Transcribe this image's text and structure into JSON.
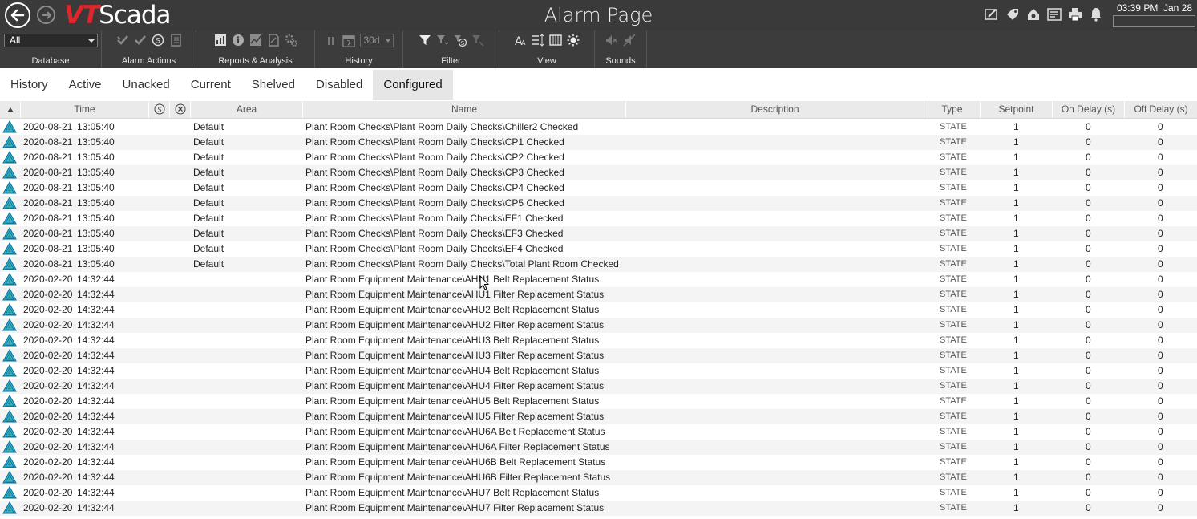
{
  "titlebar": {
    "logo_vt": "VT",
    "logo_scada": "Scada",
    "page_title": "Alarm Page",
    "time": "03:39 PM",
    "date": "Jan 28",
    "icons": [
      "draw-icon",
      "tag-icon",
      "home-settings-icon",
      "add-list-icon",
      "print-icon",
      "bell-icon"
    ]
  },
  "toolbar": {
    "database_value": "All",
    "history_range": "30d",
    "groups": [
      {
        "label": "Database"
      },
      {
        "label": "Alarm Actions"
      },
      {
        "label": "Reports & Analysis"
      },
      {
        "label": "History"
      },
      {
        "label": "Filter"
      },
      {
        "label": "View"
      },
      {
        "label": "Sounds"
      }
    ]
  },
  "tabs": [
    "History",
    "Active",
    "Unacked",
    "Current",
    "Shelved",
    "Disabled",
    "Configured"
  ],
  "active_tab": "Configured",
  "columns": {
    "time": "Time",
    "area": "Area",
    "name": "Name",
    "description": "Description",
    "type": "Type",
    "setpoint": "Setpoint",
    "on_delay": "On Delay (s)",
    "off_delay": "Off Delay (s)"
  },
  "rows": [
    {
      "date": "2020-08-21",
      "time": "13:05:40",
      "area": "Default",
      "name": "Plant Room Checks\\Plant Room Daily Checks\\Chiller2 Checked",
      "type": "STATE",
      "setpoint": "1",
      "on": "0",
      "off": "0"
    },
    {
      "date": "2020-08-21",
      "time": "13:05:40",
      "area": "Default",
      "name": "Plant Room Checks\\Plant Room Daily Checks\\CP1 Checked",
      "type": "STATE",
      "setpoint": "1",
      "on": "0",
      "off": "0"
    },
    {
      "date": "2020-08-21",
      "time": "13:05:40",
      "area": "Default",
      "name": "Plant Room Checks\\Plant Room Daily Checks\\CP2 Checked",
      "type": "STATE",
      "setpoint": "1",
      "on": "0",
      "off": "0"
    },
    {
      "date": "2020-08-21",
      "time": "13:05:40",
      "area": "Default",
      "name": "Plant Room Checks\\Plant Room Daily Checks\\CP3 Checked",
      "type": "STATE",
      "setpoint": "1",
      "on": "0",
      "off": "0"
    },
    {
      "date": "2020-08-21",
      "time": "13:05:40",
      "area": "Default",
      "name": "Plant Room Checks\\Plant Room Daily Checks\\CP4 Checked",
      "type": "STATE",
      "setpoint": "1",
      "on": "0",
      "off": "0"
    },
    {
      "date": "2020-08-21",
      "time": "13:05:40",
      "area": "Default",
      "name": "Plant Room Checks\\Plant Room Daily Checks\\CP5 Checked",
      "type": "STATE",
      "setpoint": "1",
      "on": "0",
      "off": "0"
    },
    {
      "date": "2020-08-21",
      "time": "13:05:40",
      "area": "Default",
      "name": "Plant Room Checks\\Plant Room Daily Checks\\EF1 Checked",
      "type": "STATE",
      "setpoint": "1",
      "on": "0",
      "off": "0"
    },
    {
      "date": "2020-08-21",
      "time": "13:05:40",
      "area": "Default",
      "name": "Plant Room Checks\\Plant Room Daily Checks\\EF3 Checked",
      "type": "STATE",
      "setpoint": "1",
      "on": "0",
      "off": "0"
    },
    {
      "date": "2020-08-21",
      "time": "13:05:40",
      "area": "Default",
      "name": "Plant Room Checks\\Plant Room Daily Checks\\EF4 Checked",
      "type": "STATE",
      "setpoint": "1",
      "on": "0",
      "off": "0"
    },
    {
      "date": "2020-08-21",
      "time": "13:05:40",
      "area": "Default",
      "name": "Plant Room Checks\\Plant Room Daily Checks\\Total Plant Room Checked",
      "type": "STATE",
      "setpoint": "1",
      "on": "0",
      "off": "0"
    },
    {
      "date": "2020-02-20",
      "time": "14:32:44",
      "area": "",
      "name": "Plant Room Equipment Maintenance\\AHU1 Belt Replacement Status",
      "type": "STATE",
      "setpoint": "1",
      "on": "0",
      "off": "0"
    },
    {
      "date": "2020-02-20",
      "time": "14:32:44",
      "area": "",
      "name": "Plant Room Equipment Maintenance\\AHU1 Filter Replacement Status",
      "type": "STATE",
      "setpoint": "1",
      "on": "0",
      "off": "0"
    },
    {
      "date": "2020-02-20",
      "time": "14:32:44",
      "area": "",
      "name": "Plant Room Equipment Maintenance\\AHU2 Belt Replacement Status",
      "type": "STATE",
      "setpoint": "1",
      "on": "0",
      "off": "0"
    },
    {
      "date": "2020-02-20",
      "time": "14:32:44",
      "area": "",
      "name": "Plant Room Equipment Maintenance\\AHU2 Filter Replacement Status",
      "type": "STATE",
      "setpoint": "1",
      "on": "0",
      "off": "0"
    },
    {
      "date": "2020-02-20",
      "time": "14:32:44",
      "area": "",
      "name": "Plant Room Equipment Maintenance\\AHU3 Belt Replacement Status",
      "type": "STATE",
      "setpoint": "1",
      "on": "0",
      "off": "0"
    },
    {
      "date": "2020-02-20",
      "time": "14:32:44",
      "area": "",
      "name": "Plant Room Equipment Maintenance\\AHU3 Filter Replacement Status",
      "type": "STATE",
      "setpoint": "1",
      "on": "0",
      "off": "0"
    },
    {
      "date": "2020-02-20",
      "time": "14:32:44",
      "area": "",
      "name": "Plant Room Equipment Maintenance\\AHU4 Belt Replacement Status",
      "type": "STATE",
      "setpoint": "1",
      "on": "0",
      "off": "0"
    },
    {
      "date": "2020-02-20",
      "time": "14:32:44",
      "area": "",
      "name": "Plant Room Equipment Maintenance\\AHU4 Filter Replacement Status",
      "type": "STATE",
      "setpoint": "1",
      "on": "0",
      "off": "0"
    },
    {
      "date": "2020-02-20",
      "time": "14:32:44",
      "area": "",
      "name": "Plant Room Equipment Maintenance\\AHU5 Belt Replacement Status",
      "type": "STATE",
      "setpoint": "1",
      "on": "0",
      "off": "0"
    },
    {
      "date": "2020-02-20",
      "time": "14:32:44",
      "area": "",
      "name": "Plant Room Equipment Maintenance\\AHU5 Filter Replacement Status",
      "type": "STATE",
      "setpoint": "1",
      "on": "0",
      "off": "0"
    },
    {
      "date": "2020-02-20",
      "time": "14:32:44",
      "area": "",
      "name": "Plant Room Equipment Maintenance\\AHU6A Belt Replacement Status",
      "type": "STATE",
      "setpoint": "1",
      "on": "0",
      "off": "0"
    },
    {
      "date": "2020-02-20",
      "time": "14:32:44",
      "area": "",
      "name": "Plant Room Equipment Maintenance\\AHU6A Filter Replacement Status",
      "type": "STATE",
      "setpoint": "1",
      "on": "0",
      "off": "0"
    },
    {
      "date": "2020-02-20",
      "time": "14:32:44",
      "area": "",
      "name": "Plant Room Equipment Maintenance\\AHU6B Belt Replacement Status",
      "type": "STATE",
      "setpoint": "1",
      "on": "0",
      "off": "0"
    },
    {
      "date": "2020-02-20",
      "time": "14:32:44",
      "area": "",
      "name": "Plant Room Equipment Maintenance\\AHU6B Filter Replacement Status",
      "type": "STATE",
      "setpoint": "1",
      "on": "0",
      "off": "0"
    },
    {
      "date": "2020-02-20",
      "time": "14:32:44",
      "area": "",
      "name": "Plant Room Equipment Maintenance\\AHU7 Belt Replacement Status",
      "type": "STATE",
      "setpoint": "1",
      "on": "0",
      "off": "0"
    },
    {
      "date": "2020-02-20",
      "time": "14:32:44",
      "area": "",
      "name": "Plant Room Equipment Maintenance\\AHU7 Filter Replacement Status",
      "type": "STATE",
      "setpoint": "1",
      "on": "0",
      "off": "0"
    }
  ]
}
